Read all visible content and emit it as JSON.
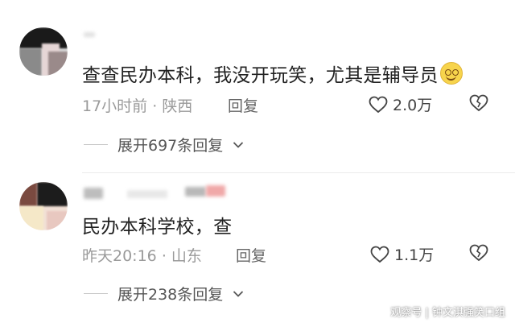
{
  "comments": [
    {
      "text": "查查民办本科，我没开玩笑，尤其是辅导员",
      "emoji": "smiling-face",
      "time": "17小时前",
      "location": "陕西",
      "reply_label": "回复",
      "likes": "2.0万",
      "expand_label": "展开697条回复"
    },
    {
      "text": "民办本科学校，查",
      "time": "昨天20:16",
      "location": "山东",
      "reply_label": "回复",
      "likes": "1.1万",
      "expand_label": "展开238条回复"
    }
  ],
  "separator": "·",
  "watermark": "观察号 | 钟文淇强笑口组",
  "colors": {
    "text": "#222222",
    "meta": "#9a9a9a",
    "emoji": "#f7d44c"
  }
}
